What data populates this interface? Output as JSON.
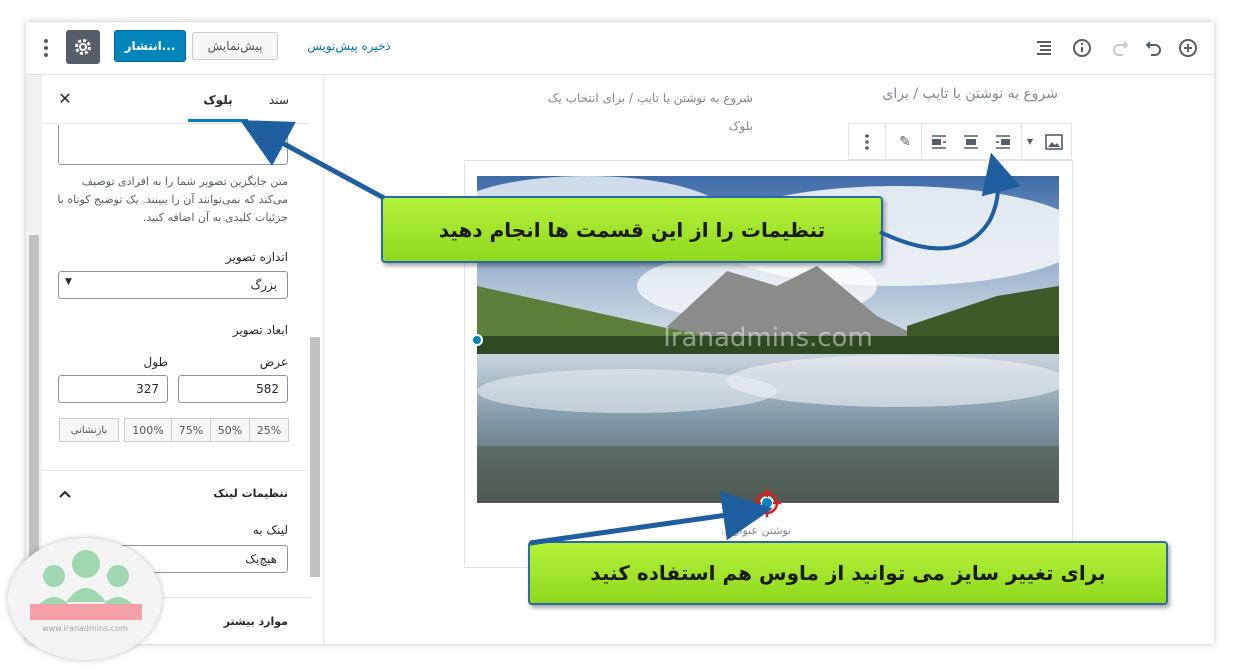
{
  "topbar": {
    "publish_label": "انتشار...",
    "preview_label": "پیش‌نمایش",
    "save_draft_label": "ذخیره پیش‌نویس"
  },
  "sidebar": {
    "tab_document": "سند",
    "tab_block": "بلوک",
    "alt_help": "متن جایگزین تصویر شما را به افرادی توصیف می‌کند که نمی‌توانند آن را ببینند. یک توضیح کوتاه با جزئیات کلیدی به آن اضافه کنید.",
    "image_size_label": "اندازه تصویر",
    "image_size_value": "بزرگ",
    "dimensions_label": "ابعاد تصویر",
    "width_label": "عرض",
    "height_label": "طول",
    "width_value": "582",
    "height_value": "327",
    "pct_buttons": [
      "25%",
      "50%",
      "75%",
      "100%"
    ],
    "reset_label": "بازنشانی",
    "link_settings_title": "تنظیمات لینک",
    "link_to_label": "لینک به",
    "link_to_value": "هیچ‌یک",
    "more_options_title": "موارد بیشتر"
  },
  "editor": {
    "placeholder_left": "شروع به نوشتن یا تایپ / برای انتخاب یک بلوک",
    "placeholder_right": "شروع به نوشتن یا تایپ / برای",
    "caption_placeholder": "نوشتن عنوان...",
    "watermark": "Iranadmins.com"
  },
  "callouts": {
    "top": "تنظیمات را از این قسمت ها انجام دهید",
    "bottom": "برای تغییر سایز می توانید از ماوس هم استفاده کنید"
  },
  "logo": {
    "site_text": "www.iranadmins.com"
  },
  "colors": {
    "primary": "#0085ba",
    "callout_green": "#9be62a",
    "arrow_blue": "#1f5fa0"
  }
}
